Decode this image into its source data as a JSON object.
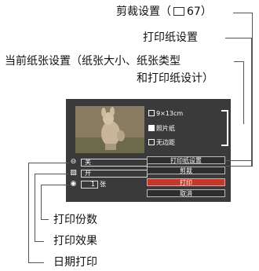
{
  "callouts": {
    "trim": "剪裁设置（\u001a 67）",
    "trim_text": "剪裁设置（",
    "trim_page": "67）",
    "paper": "打印纸设置",
    "current_1": "当前纸张设置（纸张大小、纸张类型",
    "current_2": "和打印纸设计）",
    "copies": "打印份数",
    "effect": "打印效果",
    "date": "日期打印"
  },
  "screen": {
    "paper_size": "9×13cm",
    "paper_type": "照片纸",
    "layout": "无边距",
    "date_value": "关",
    "effect_value": "开",
    "copies_value": "1",
    "copies_unit": "张",
    "buttons": [
      "打印纸设置",
      "剪裁",
      "打印",
      "取消"
    ],
    "selected_button": "打印"
  },
  "colors": {
    "screen_bg": "#3a3a3a",
    "selected": "#c0392b"
  }
}
